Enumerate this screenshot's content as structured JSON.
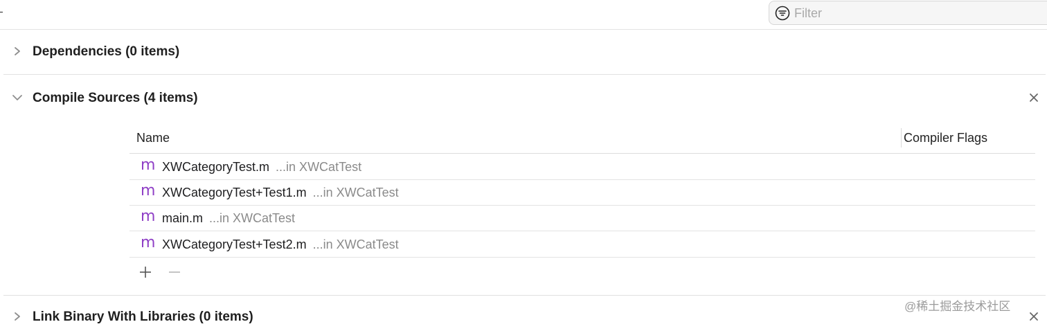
{
  "filter": {
    "placeholder": "Filter"
  },
  "sections": {
    "dependencies": {
      "title": "Dependencies (0 items)"
    },
    "compile_sources": {
      "title": "Compile Sources (4 items)",
      "columns": {
        "name": "Name",
        "flags": "Compiler Flags"
      },
      "files": [
        {
          "icon": "objc-m-file-icon",
          "glyph": "m",
          "name": "XWCategoryTest.m",
          "location": "...in XWCatTest"
        },
        {
          "icon": "objc-m-file-icon",
          "glyph": "m",
          "name": "XWCategoryTest+Test1.m",
          "location": "...in XWCatTest"
        },
        {
          "icon": "objc-m-file-icon",
          "glyph": "m",
          "name": "main.m",
          "location": "...in XWCatTest"
        },
        {
          "icon": "objc-m-file-icon",
          "glyph": "m",
          "name": "XWCategoryTest+Test2.m",
          "location": "...in XWCatTest"
        }
      ],
      "add_symbol": "+",
      "remove_symbol": "−"
    },
    "link_binary": {
      "title": "Link Binary With Libraries (0 items)"
    }
  },
  "watermark": "@稀土掘金技术社区",
  "colors": {
    "file_icon": "#8f3fc6",
    "secondary_text": "#8a8a8a"
  }
}
